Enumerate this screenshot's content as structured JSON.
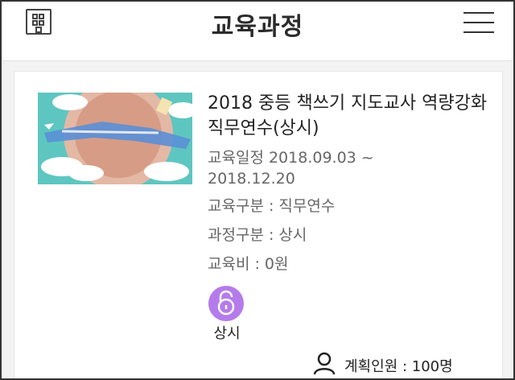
{
  "header": {
    "title": "교육과정",
    "home_icon": "building-icon",
    "menu_icon": "hamburger-menu-icon"
  },
  "course": {
    "title": "2018 중등 책쓰기 지도교사 역량강화 직무연수(상시)",
    "schedule": "교육일정 2018.09.03 ~",
    "schedule_end": "2018.12.20",
    "category": "교육구분 : 직무연수",
    "course_type": "과정구분 : 상시",
    "fee": "교육비 : 0원",
    "badge_label": "상시",
    "badge_icon": "open-lock-icon",
    "capacity": "계획인원 : 100명",
    "capacity_icon": "person-icon"
  },
  "colors": {
    "badge": "#b57bea",
    "thumb_bg": "#5ec6c0"
  }
}
